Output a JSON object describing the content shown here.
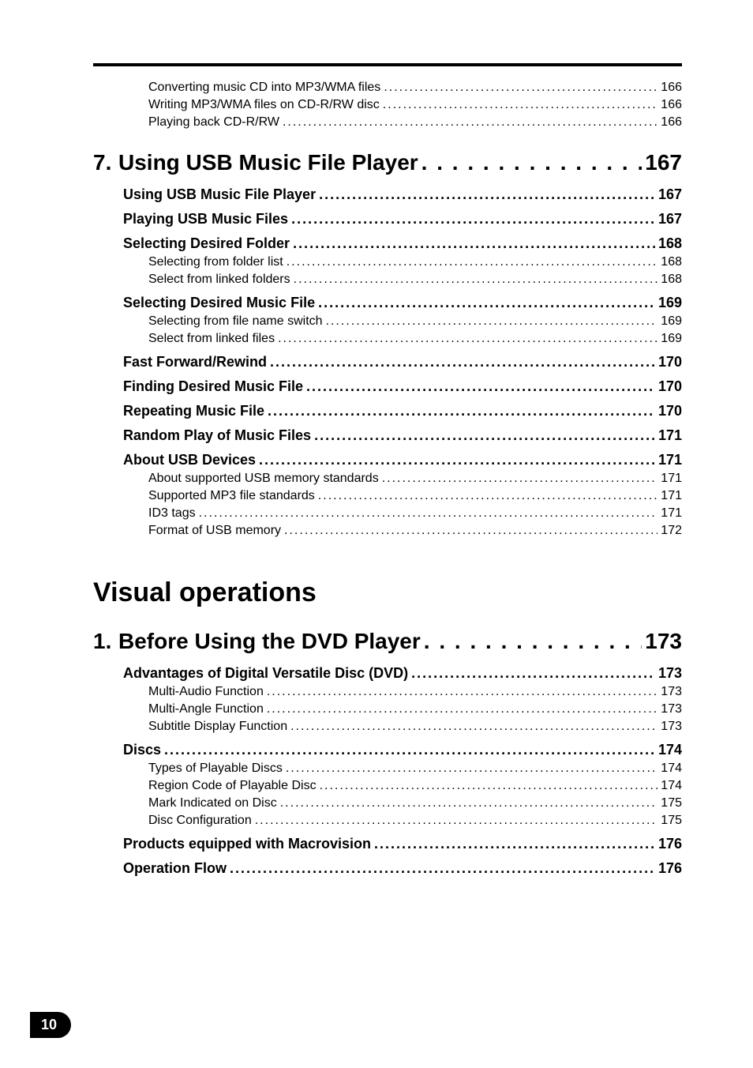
{
  "page_number": "10",
  "top_items": [
    {
      "label": "Converting music CD into MP3/WMA files",
      "page": "166"
    },
    {
      "label": "Writing MP3/WMA files on CD-R/RW disc",
      "page": "166"
    },
    {
      "label": "Playing back CD-R/RW",
      "page": "166"
    }
  ],
  "chapter7": {
    "num": "7.",
    "title": "Using USB Music File Player",
    "page": "167",
    "sections": [
      {
        "label": "Using USB Music File Player",
        "page": "167",
        "items": []
      },
      {
        "label": "Playing USB Music Files",
        "page": "167",
        "items": []
      },
      {
        "label": "Selecting Desired Folder",
        "page": "168",
        "items": [
          {
            "label": "Selecting from folder list",
            "page": "168"
          },
          {
            "label": "Select from linked folders",
            "page": "168"
          }
        ]
      },
      {
        "label": "Selecting Desired Music File",
        "page": "169",
        "items": [
          {
            "label": "Selecting from file name switch",
            "page": "169"
          },
          {
            "label": "Select from linked files",
            "page": "169"
          }
        ]
      },
      {
        "label": "Fast Forward/Rewind",
        "page": "170",
        "items": []
      },
      {
        "label": "Finding Desired Music File",
        "page": "170",
        "items": []
      },
      {
        "label": "Repeating Music File",
        "page": "170",
        "items": []
      },
      {
        "label": "Random Play of Music Files",
        "page": "171",
        "items": []
      },
      {
        "label": "About USB Devices",
        "page": "171",
        "items": [
          {
            "label": "About supported USB memory standards",
            "page": "171"
          },
          {
            "label": "Supported MP3 file standards",
            "page": "171"
          },
          {
            "label": "ID3 tags",
            "page": "171"
          },
          {
            "label": "Format of USB memory",
            "page": "172"
          }
        ]
      }
    ]
  },
  "part_heading": "Visual operations",
  "chapter1": {
    "num": "1.",
    "title": "Before Using the DVD Player",
    "page": "173",
    "sections": [
      {
        "label": "Advantages of Digital Versatile Disc (DVD)",
        "page": "173",
        "items": [
          {
            "label": "Multi-Audio Function",
            "page": "173"
          },
          {
            "label": "Multi-Angle Function",
            "page": "173"
          },
          {
            "label": "Subtitle Display Function",
            "page": "173"
          }
        ]
      },
      {
        "label": "Discs",
        "page": "174",
        "items": [
          {
            "label": "Types of Playable Discs",
            "page": "174"
          },
          {
            "label": "Region Code of Playable Disc",
            "page": "174"
          },
          {
            "label": "Mark Indicated on Disc",
            "page": "175"
          },
          {
            "label": "Disc Configuration",
            "page": "175"
          }
        ]
      },
      {
        "label": "Products equipped with Macrovision",
        "page": "176",
        "items": []
      },
      {
        "label": "Operation Flow",
        "page": "176",
        "items": []
      }
    ]
  }
}
